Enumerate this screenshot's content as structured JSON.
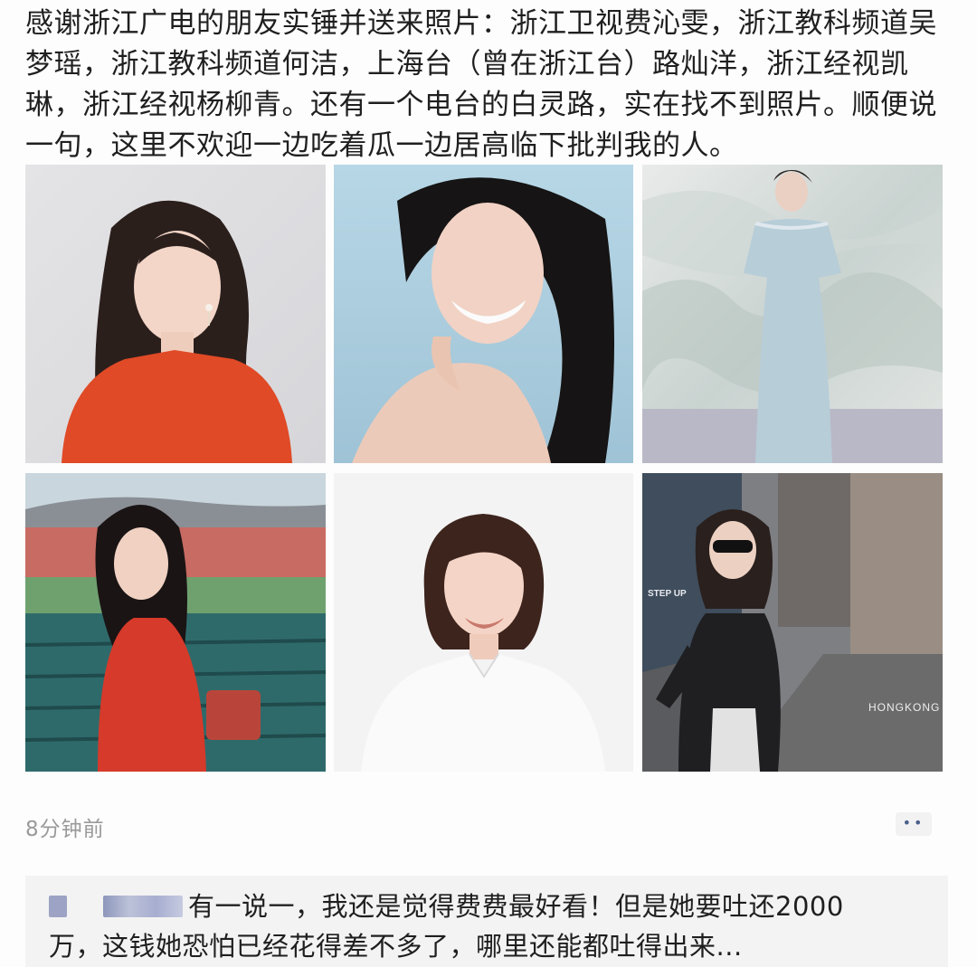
{
  "post": {
    "text_lines": [
      "感谢浙江广电的朋友实锤并送来照片：浙江卫视费沁雯，浙江教科频道吴",
      "梦瑶，浙江教科频道何洁，上海台（曾在浙江台）路灿洋，浙江经视凯",
      "琳，浙江经视杨柳青。还有一个电台的白灵路，实在找不到照片。顺便说",
      "一句，这里不欢迎一边吃着瓜一边居高临下批判我的人。"
    ],
    "photos": [
      {
        "icon": "photo-woman-red-top"
      },
      {
        "icon": "photo-woman-smiling-blue"
      },
      {
        "icon": "photo-woman-blue-gown"
      },
      {
        "icon": "photo-woman-stadium"
      },
      {
        "icon": "photo-woman-white-shirt"
      },
      {
        "icon": "photo-woman-street-sunglasses"
      }
    ],
    "photo_overlay_texts": {
      "street_sign": "STEP UP",
      "watermark": "HONGKONG"
    },
    "timestamp": "8分钟前",
    "more_button_glyph": "••"
  },
  "comment": {
    "line1": "有一说一，我还是觉得费费最好看！但是她要吐还2000",
    "line2": "万，这钱她恐怕已经花得差不多了，哪里还能都吐得出来..."
  },
  "colors": {
    "text": "#1f1f1f",
    "timestamp": "#9a9a9a",
    "comment_bg": "#f3f3f3",
    "accent_link": "#4a5f8a"
  }
}
